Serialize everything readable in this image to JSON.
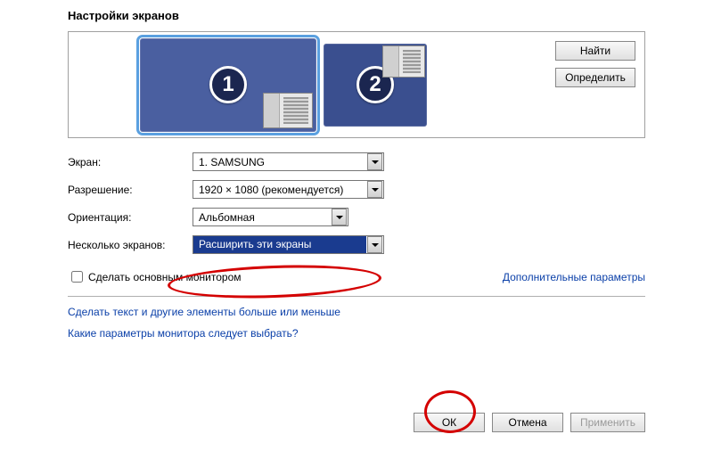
{
  "title": "Настройки экранов",
  "monitors": {
    "num1": "1",
    "num2": "2"
  },
  "side_buttons": {
    "find": "Найти",
    "identify": "Определить"
  },
  "labels": {
    "screen": "Экран:",
    "resolution": "Разрешение:",
    "orientation": "Ориентация:",
    "multiple": "Несколько экранов:"
  },
  "values": {
    "screen": "1. SAMSUNG",
    "resolution": "1920 × 1080 (рекомендуется)",
    "orientation": "Альбомная",
    "multiple": "Расширить эти экраны"
  },
  "checkbox_label": "Сделать основным монитором",
  "adv_link": "Дополнительные параметры",
  "links": {
    "text_size": "Сделать текст и другие элементы больше или меньше",
    "which_params": "Какие параметры монитора следует выбрать?"
  },
  "buttons": {
    "ok": "ОК",
    "cancel": "Отмена",
    "apply": "Применить"
  }
}
